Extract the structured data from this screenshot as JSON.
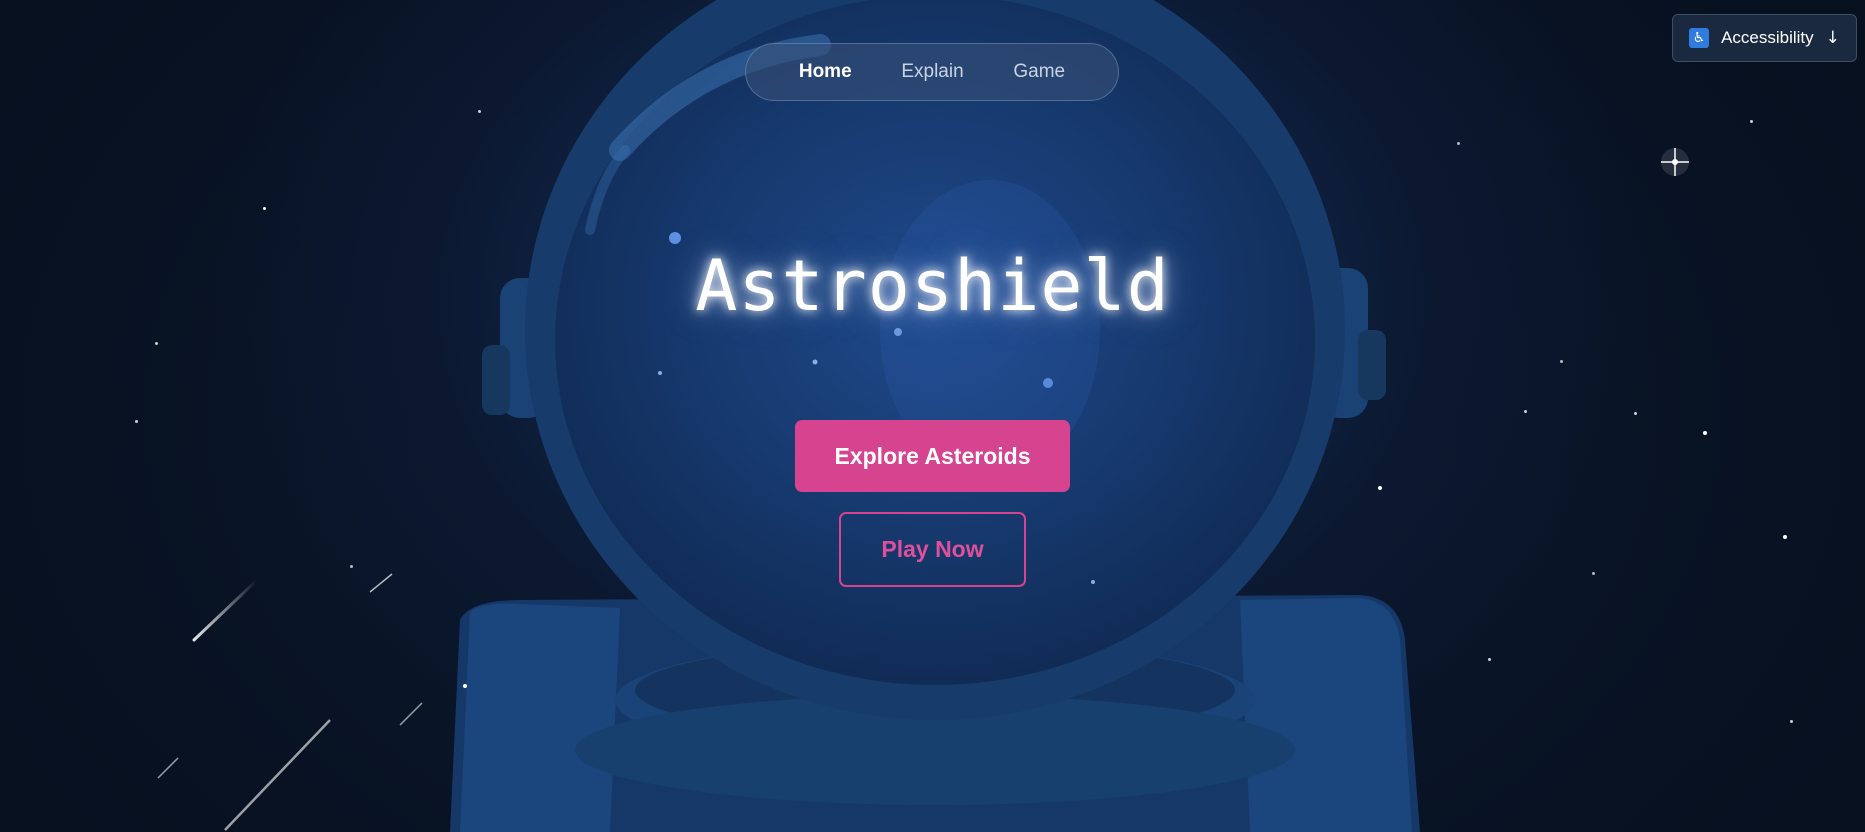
{
  "nav": {
    "items": [
      {
        "label": "Home",
        "active": true
      },
      {
        "label": "Explain",
        "active": false
      },
      {
        "label": "Game",
        "active": false
      }
    ]
  },
  "accessibility": {
    "label": "Accessibility",
    "icon": "wheelchair-icon",
    "arrow": "↓"
  },
  "hero": {
    "title": "Astroshield",
    "primary_button": "Explore Asteroids",
    "secondary_button": "Play Now"
  },
  "colors": {
    "accent": "#d6438f",
    "background": "#07101f",
    "helmet": "#1b3a66"
  }
}
